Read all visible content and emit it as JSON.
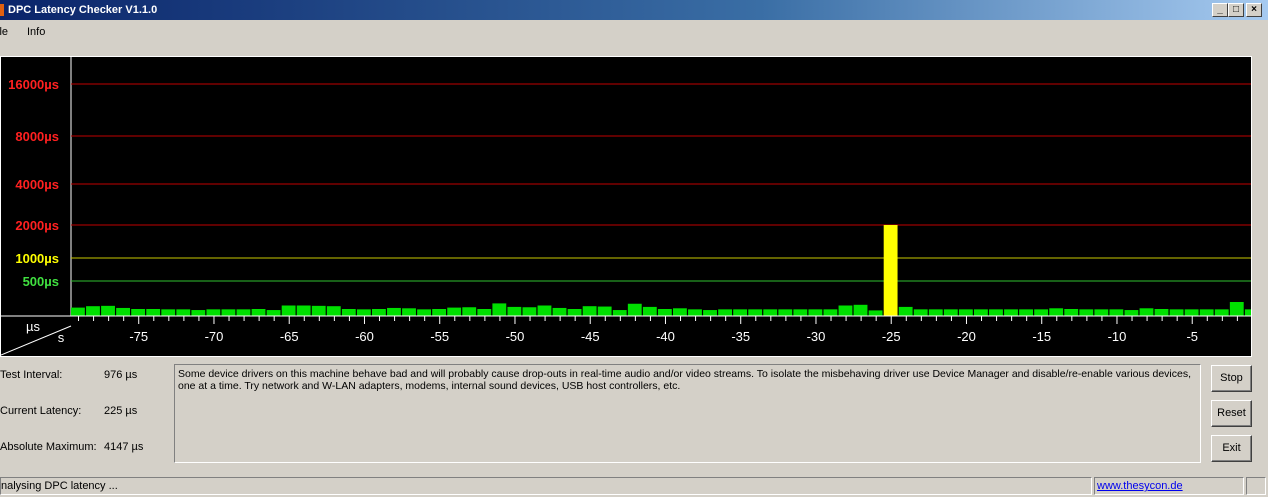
{
  "window": {
    "title": "DPC Latency Checker V1.1.0",
    "min_symbol": "_",
    "max_symbol": "□",
    "close_symbol": "×"
  },
  "menu": {
    "file": "ile",
    "info": "Info"
  },
  "chart_data": {
    "type": "bar",
    "ylabel_unit": "µs",
    "xlabel_unit": "s",
    "y_levels": [
      {
        "label": "16000µs",
        "value": 16000,
        "color": "#ff2020"
      },
      {
        "label": "8000µs",
        "value": 8000,
        "color": "#ff2020"
      },
      {
        "label": "4000µs",
        "value": 4000,
        "color": "#ff2020"
      },
      {
        "label": "2000µs",
        "value": 2000,
        "color": "#ff2020"
      },
      {
        "label": "1000µs",
        "value": 1000,
        "color": "#ffff00"
      },
      {
        "label": "500µs",
        "value": 500,
        "color": "#40e040"
      }
    ],
    "x_ticks": [
      "-75",
      "-70",
      "-65",
      "-60",
      "-55",
      "-50",
      "-45",
      "-40",
      "-35",
      "-30",
      "-25",
      "-20",
      "-15",
      "-10",
      "-5"
    ],
    "x_tick_values": [
      -75,
      -70,
      -65,
      -60,
      -55,
      -50,
      -45,
      -40,
      -35,
      -30,
      -25,
      -20,
      -15,
      -10,
      -5
    ],
    "x_range": [
      -79,
      -0.3
    ],
    "bar_colors": {
      "ok": "#00e000",
      "warn": "#ffff00"
    },
    "bars": [
      {
        "x": -79,
        "y": 120
      },
      {
        "x": -78,
        "y": 140
      },
      {
        "x": -77,
        "y": 145
      },
      {
        "x": -76,
        "y": 115
      },
      {
        "x": -75,
        "y": 100
      },
      {
        "x": -74,
        "y": 100
      },
      {
        "x": -73,
        "y": 95
      },
      {
        "x": -72,
        "y": 95
      },
      {
        "x": -71,
        "y": 85
      },
      {
        "x": -70,
        "y": 95
      },
      {
        "x": -69,
        "y": 95
      },
      {
        "x": -68,
        "y": 95
      },
      {
        "x": -67,
        "y": 100
      },
      {
        "x": -66,
        "y": 85
      },
      {
        "x": -65,
        "y": 150
      },
      {
        "x": -64,
        "y": 150
      },
      {
        "x": -63,
        "y": 145
      },
      {
        "x": -62,
        "y": 140
      },
      {
        "x": -61,
        "y": 100
      },
      {
        "x": -60,
        "y": 95
      },
      {
        "x": -59,
        "y": 100
      },
      {
        "x": -58,
        "y": 115
      },
      {
        "x": -57,
        "y": 110
      },
      {
        "x": -56,
        "y": 95
      },
      {
        "x": -55,
        "y": 100
      },
      {
        "x": -54,
        "y": 120
      },
      {
        "x": -53,
        "y": 125
      },
      {
        "x": -52,
        "y": 100
      },
      {
        "x": -51,
        "y": 180
      },
      {
        "x": -50,
        "y": 130
      },
      {
        "x": -49,
        "y": 125
      },
      {
        "x": -48,
        "y": 150
      },
      {
        "x": -47,
        "y": 115
      },
      {
        "x": -46,
        "y": 100
      },
      {
        "x": -45,
        "y": 140
      },
      {
        "x": -44,
        "y": 135
      },
      {
        "x": -43,
        "y": 85
      },
      {
        "x": -42,
        "y": 175
      },
      {
        "x": -41,
        "y": 130
      },
      {
        "x": -40,
        "y": 100
      },
      {
        "x": -39,
        "y": 110
      },
      {
        "x": -38,
        "y": 95
      },
      {
        "x": -37,
        "y": 85
      },
      {
        "x": -36,
        "y": 95
      },
      {
        "x": -35,
        "y": 95
      },
      {
        "x": -34,
        "y": 95
      },
      {
        "x": -33,
        "y": 95
      },
      {
        "x": -32,
        "y": 95
      },
      {
        "x": -31,
        "y": 95
      },
      {
        "x": -30,
        "y": 95
      },
      {
        "x": -29,
        "y": 95
      },
      {
        "x": -28,
        "y": 150
      },
      {
        "x": -27,
        "y": 160
      },
      {
        "x": -26,
        "y": 80
      },
      {
        "x": -25,
        "y": 2000
      },
      {
        "x": -24,
        "y": 130
      },
      {
        "x": -23,
        "y": 95
      },
      {
        "x": -22,
        "y": 95
      },
      {
        "x": -21,
        "y": 95
      },
      {
        "x": -20,
        "y": 95
      },
      {
        "x": -19,
        "y": 95
      },
      {
        "x": -18,
        "y": 95
      },
      {
        "x": -17,
        "y": 95
      },
      {
        "x": -16,
        "y": 95
      },
      {
        "x": -15,
        "y": 95
      },
      {
        "x": -14,
        "y": 110
      },
      {
        "x": -13,
        "y": 100
      },
      {
        "x": -12,
        "y": 95
      },
      {
        "x": -11,
        "y": 95
      },
      {
        "x": -10,
        "y": 95
      },
      {
        "x": -9,
        "y": 85
      },
      {
        "x": -8,
        "y": 110
      },
      {
        "x": -7,
        "y": 100
      },
      {
        "x": -6,
        "y": 95
      },
      {
        "x": -5,
        "y": 95
      },
      {
        "x": -4,
        "y": 95
      },
      {
        "x": -3,
        "y": 95
      },
      {
        "x": -2,
        "y": 200
      },
      {
        "x": -1,
        "y": 95
      },
      {
        "x": 0,
        "y": 95
      }
    ]
  },
  "stats": {
    "test_interval_label": "Test Interval:",
    "test_interval_value": "976 µs",
    "current_latency_label": "Current Latency:",
    "current_latency_value": "225 µs",
    "absolute_max_label": "Absolute Maximum:",
    "absolute_max_value": "4147 µs"
  },
  "message": "Some device drivers on this machine behave bad and will probably cause drop-outs in real-time audio and/or video streams. To isolate the misbehaving driver use Device Manager and disable/re-enable various devices, one at a time. Try network and W-LAN adapters, modems, internal sound devices, USB host controllers, etc.",
  "buttons": {
    "stop": "Stop",
    "reset": "Reset",
    "exit": "Exit"
  },
  "status": {
    "text": "nalysing DPC latency ...",
    "link": "www.thesycon.de"
  }
}
